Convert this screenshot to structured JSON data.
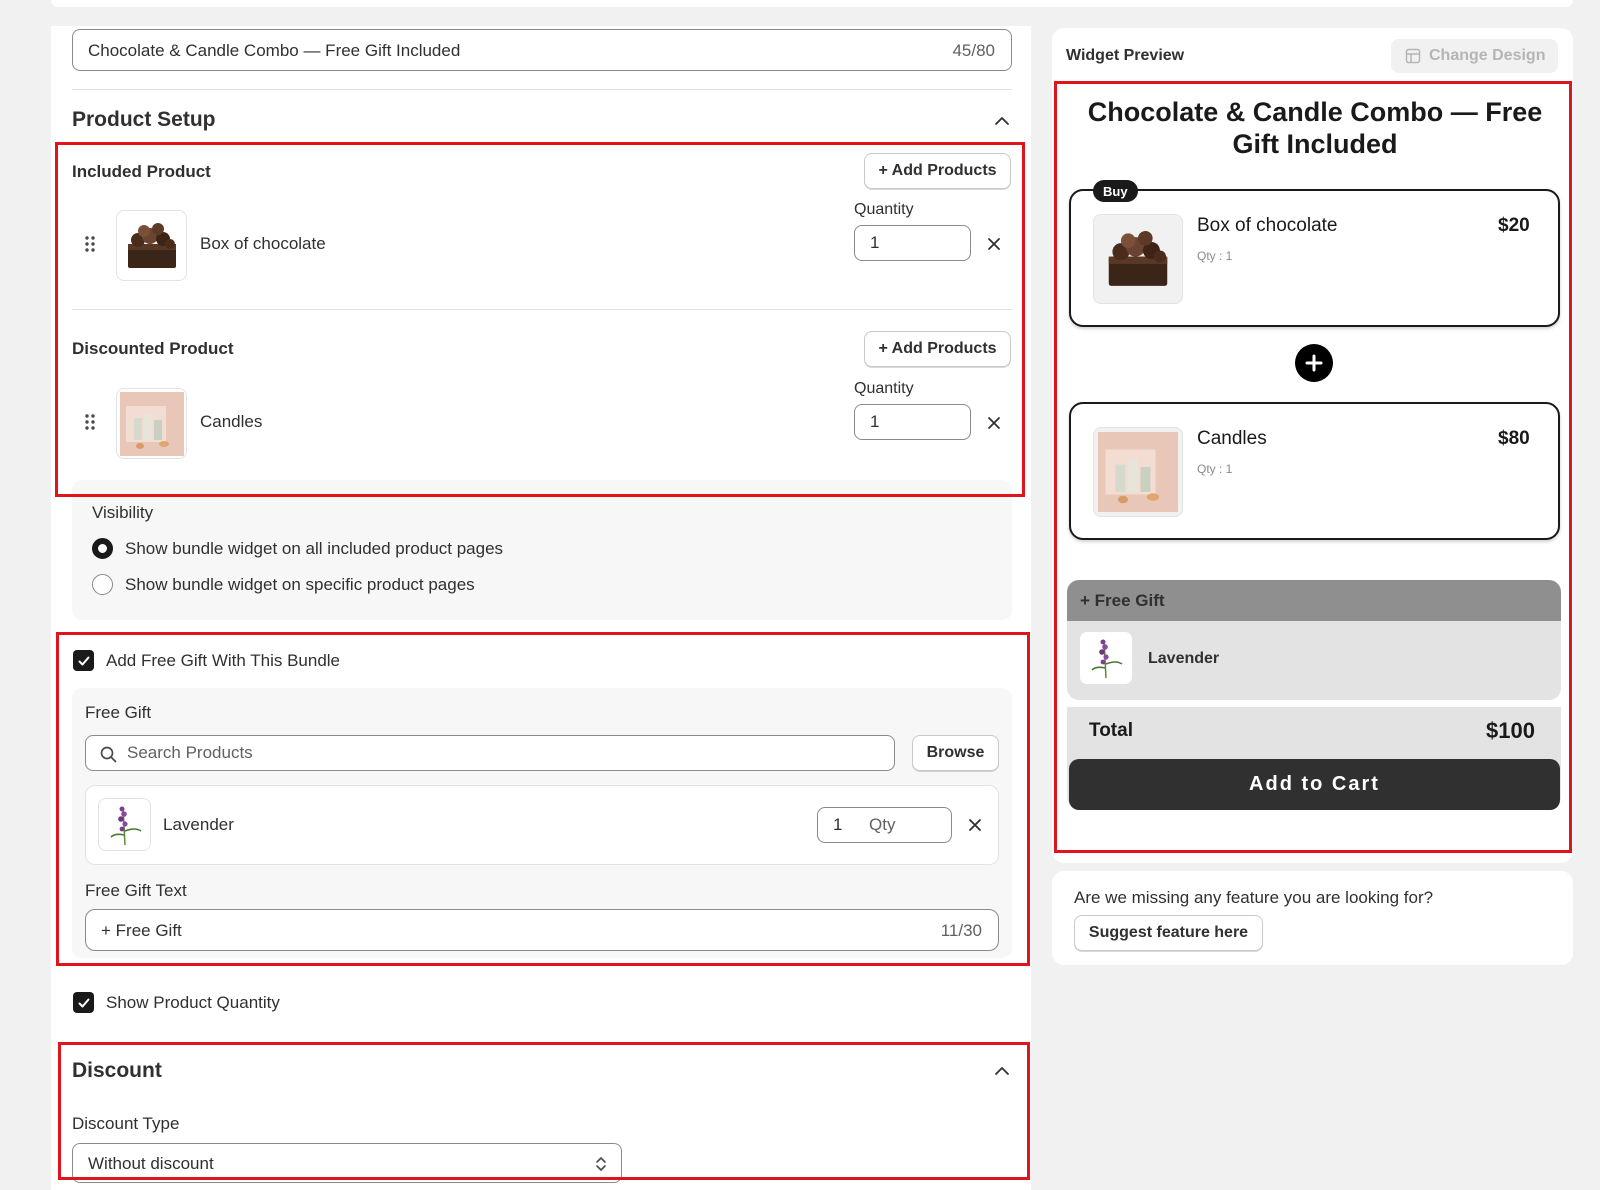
{
  "editor": {
    "title_value": "Chocolate & Candle Combo — Free Gift Included",
    "title_count": "45/80",
    "product_setup": {
      "heading": "Product Setup",
      "included": {
        "label": "Included Product",
        "add_button": "+ Add Products",
        "quantity_label": "Quantity",
        "product_name": "Box of chocolate",
        "quantity": "1"
      },
      "discounted": {
        "label": "Discounted Product",
        "add_button": "+ Add Products",
        "quantity_label": "Quantity",
        "product_name": "Candles",
        "quantity": "1"
      },
      "visibility": {
        "label": "Visibility",
        "options": [
          {
            "label": "Show bundle widget on all included product pages",
            "selected": true
          },
          {
            "label": "Show bundle widget on specific product pages",
            "selected": false
          }
        ]
      }
    },
    "free_gift": {
      "checkbox_label": "Add Free Gift With This Bundle",
      "checked": true,
      "label": "Free Gift",
      "search_placeholder": "Search Products",
      "browse_button": "Browse",
      "gift_name": "Lavender",
      "gift_qty": "1",
      "qty_suffix": "Qty",
      "text_label": "Free Gift Text",
      "text_value": "+ Free Gift",
      "text_count": "11/30"
    },
    "show_quantity": {
      "label": "Show Product Quantity",
      "checked": true
    },
    "discount": {
      "heading": "Discount",
      "type_label": "Discount Type",
      "type_value": "Without discount"
    }
  },
  "preview": {
    "header_label": "Widget Preview",
    "change_design_button": "Change Design",
    "title": "Chocolate & Candle Combo — Free Gift Included",
    "buy_badge": "Buy",
    "items": [
      {
        "name": "Box of chocolate",
        "price": "$20",
        "qty": "Qty : 1"
      },
      {
        "name": "Candles",
        "price": "$80",
        "qty": "Qty : 1"
      }
    ],
    "free_gift_header": "+ Free Gift",
    "free_gift_item": "Lavender",
    "total_label": "Total",
    "total_value": "$100",
    "add_to_cart": "Add to Cart"
  },
  "feedback": {
    "question": "Are we missing any feature you are looking for?",
    "button": "Suggest feature here"
  },
  "colors": {
    "highlight": "#e0141c",
    "primary_dark": "#303030",
    "free_gift_header_bg": "#8f8f8f",
    "free_gift_body_bg": "#e3e3e3"
  }
}
